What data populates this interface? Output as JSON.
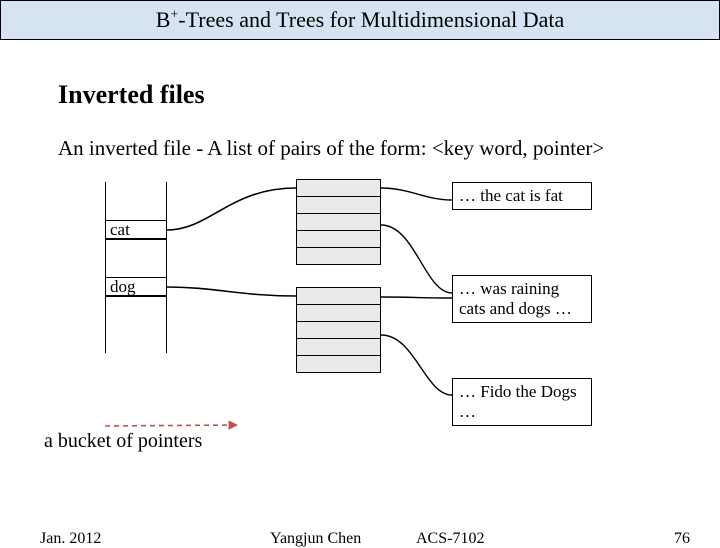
{
  "header": {
    "title_pre": "B",
    "title_sup": "+",
    "title_post": "-Trees and Trees for Multidimensional Data"
  },
  "main": {
    "heading": "Inverted files",
    "definition": "An inverted file - A list of pairs of the form: <key word, pointer>",
    "index": {
      "entries": [
        "cat",
        "dog"
      ]
    },
    "docs": [
      "… the cat is fat",
      "… was raining cats and dogs …",
      "… Fido the Dogs …"
    ],
    "bucket_caption": "a bucket of pointers"
  },
  "footer": {
    "date": "Jan. 2012",
    "author": "Yangjun Chen",
    "course": "ACS-7102",
    "page": "76"
  }
}
